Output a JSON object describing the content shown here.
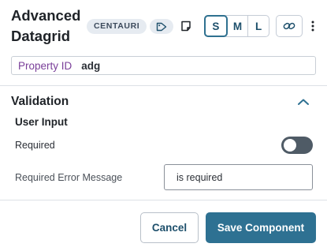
{
  "header": {
    "title_line1": "Advanced",
    "title_line2": "Datagrid",
    "badge": "CENTAURI",
    "tag_icon": "tag-icon",
    "note_icon": "sticky-note-icon",
    "sizes": [
      "S",
      "M",
      "L"
    ],
    "selected_size": "S",
    "link_icon": "link-icon",
    "more_icon": "vertical-dots-icon"
  },
  "property": {
    "label": "Property ID",
    "value": "adg"
  },
  "validation": {
    "title": "Validation",
    "collapse_icon": "chevron-up-icon",
    "user_input_title": "User Input",
    "required_label": "Required",
    "required_enabled": false,
    "error_message_label": "Required Error Message",
    "error_message_value": "is required"
  },
  "footer": {
    "cancel_label": "Cancel",
    "save_label": "Save Component"
  },
  "colors": {
    "accent": "#2e7192",
    "property_label": "#7a3f99",
    "toggle_off": "#4f5b66"
  }
}
